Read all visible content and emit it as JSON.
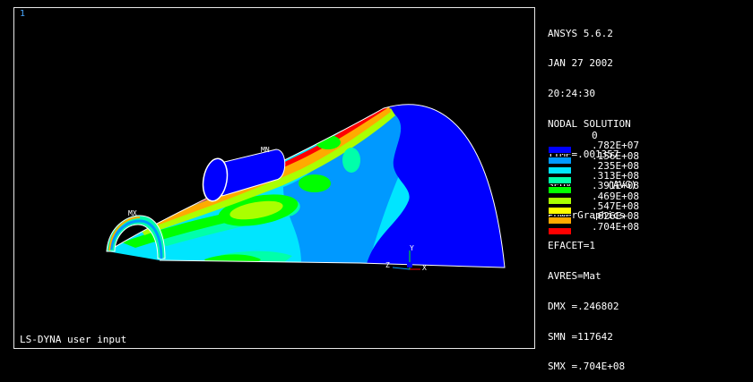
{
  "viewport": {
    "window_number": "1",
    "caption": "LS-DYNA user input",
    "labels": {
      "min": "MN",
      "max": "MX"
    },
    "triad": {
      "y": "Y",
      "z": "Z",
      "x": "X"
    }
  },
  "info": [
    "ANSYS 5.6.2",
    "JAN 27 2002",
    "20:24:30",
    "NODAL SOLUTION",
    "TIME=.001357",
    "SEQV      (AVG)",
    "PowerGraphics",
    "EFACET=1",
    "AVRES=Mat",
    "DMX =.246802",
    "SMN =117642",
    "SMX =.704E+08"
  ],
  "legend": {
    "first_label": "0",
    "items": [
      {
        "label": ".782E+07",
        "color": "#0000ff"
      },
      {
        "label": ".156E+08",
        "color": "#0099ff"
      },
      {
        "label": ".235E+08",
        "color": "#00e5ff"
      },
      {
        "label": ".313E+08",
        "color": "#00ffaa"
      },
      {
        "label": ".391E+08",
        "color": "#00ff00"
      },
      {
        "label": ".469E+08",
        "color": "#aaff00"
      },
      {
        "label": ".547E+08",
        "color": "#ffff00"
      },
      {
        "label": ".626E+08",
        "color": "#ffaa00"
      },
      {
        "label": ".704E+08",
        "color": "#ff0000"
      }
    ]
  }
}
